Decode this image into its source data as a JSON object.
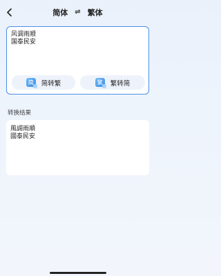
{
  "header": {
    "back_icon": "chevron-left-icon",
    "source_lang": "简体",
    "swap_symbol": "⇌",
    "target_lang": "繁体"
  },
  "input": {
    "text": "风调雨顺\n国泰民安"
  },
  "buttons": {
    "s2t": {
      "badge": "简",
      "label": "简转繁"
    },
    "t2s": {
      "badge": "繁",
      "label": "繁转简"
    }
  },
  "result": {
    "label": "转换结果",
    "text": "風調雨順\n國泰民安"
  },
  "colors": {
    "accent": "#4a8fe8",
    "badge_gradient_start": "#6fb6f5",
    "badge_gradient_end": "#3d8fe6"
  }
}
